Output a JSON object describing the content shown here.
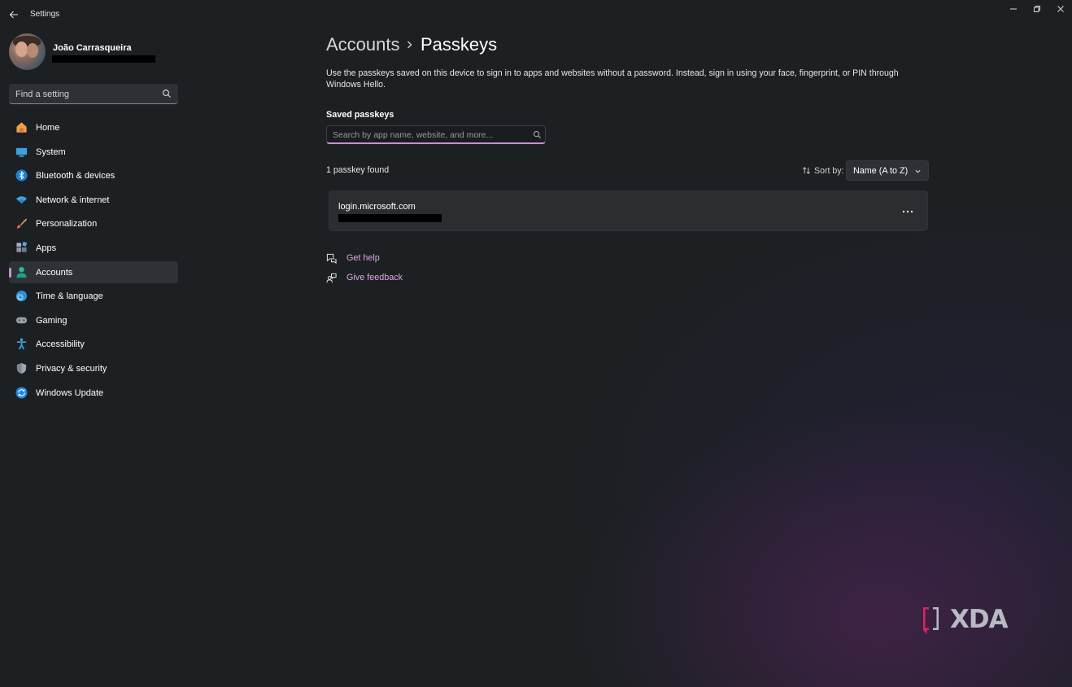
{
  "window": {
    "title": "Settings"
  },
  "user": {
    "name": "João Carrasqueira"
  },
  "search": {
    "placeholder": "Find a setting"
  },
  "nav": {
    "items": [
      {
        "label": "Home",
        "icon": "home-icon",
        "active": false
      },
      {
        "label": "System",
        "icon": "system-icon",
        "active": false
      },
      {
        "label": "Bluetooth & devices",
        "icon": "bluetooth-icon",
        "active": false
      },
      {
        "label": "Network & internet",
        "icon": "wifi-icon",
        "active": false
      },
      {
        "label": "Personalization",
        "icon": "brush-icon",
        "active": false
      },
      {
        "label": "Apps",
        "icon": "apps-icon",
        "active": false
      },
      {
        "label": "Accounts",
        "icon": "person-icon",
        "active": true
      },
      {
        "label": "Time & language",
        "icon": "globe-clock-icon",
        "active": false
      },
      {
        "label": "Gaming",
        "icon": "gamepad-icon",
        "active": false
      },
      {
        "label": "Accessibility",
        "icon": "accessibility-icon",
        "active": false
      },
      {
        "label": "Privacy & security",
        "icon": "shield-icon",
        "active": false
      },
      {
        "label": "Windows Update",
        "icon": "update-icon",
        "active": false
      }
    ]
  },
  "breadcrumb": {
    "parent": "Accounts",
    "current": "Passkeys"
  },
  "main": {
    "description": "Use the passkeys saved on this device to sign in to apps and websites without a password. Instead, sign in using your face, fingerprint, or PIN through Windows Hello.",
    "section_title": "Saved passkeys",
    "search_placeholder": "Search by app name, website, and more...",
    "found_count": "1 passkey found",
    "sort_label": "Sort by:",
    "sort_value": "Name (A to Z)",
    "passkeys": [
      {
        "site": "login.microsoft.com"
      }
    ],
    "more_label": "...",
    "get_help": "Get help",
    "give_feedback": "Give feedback"
  },
  "watermark": {
    "text": "XDA"
  },
  "colors": {
    "accent": "#c88fd3",
    "link": "#d9a9e3",
    "background": "#1c2023",
    "card": "#2a2e31"
  }
}
